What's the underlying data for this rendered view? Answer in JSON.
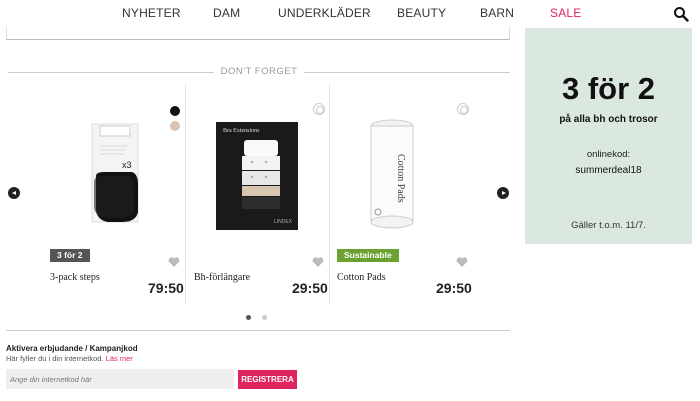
{
  "nav": {
    "items": [
      "NYHETER",
      "DAM",
      "UNDERKLÄDER",
      "BEAUTY",
      "BARN",
      "SALE"
    ]
  },
  "section": {
    "title": "DON'T FORGET"
  },
  "products": [
    {
      "name": "3-pack steps",
      "price": "79:50",
      "badge": "3 för 2",
      "box_text": "x3"
    },
    {
      "name": "Bh-förlängare",
      "price": "29:50",
      "box_title": "Bra Extensions",
      "box_brand": "LINDEX"
    },
    {
      "name": "Cotton Pads",
      "price": "29:50",
      "badge": "Sustainable",
      "box_text": "Cotton Pads"
    }
  ],
  "promo": {
    "title": "Aktivera erbjudande / Kampanjkod",
    "subtitle": "Här fyller du i din internetkod.",
    "link": "Läs mer",
    "placeholder": "Ange din internetkod här",
    "button": "REGISTRERA"
  },
  "sidebar": {
    "big": "3 för 2",
    "sub": "på alla bh och trosor",
    "label": "onlinekod:",
    "code": "summerdeal18",
    "valid": "Gäller t.o.m. 11/7."
  },
  "colors": {
    "accent": "#e0245e",
    "sustainable": "#6aa130",
    "sidebar_bg": "#dbe8e0"
  }
}
